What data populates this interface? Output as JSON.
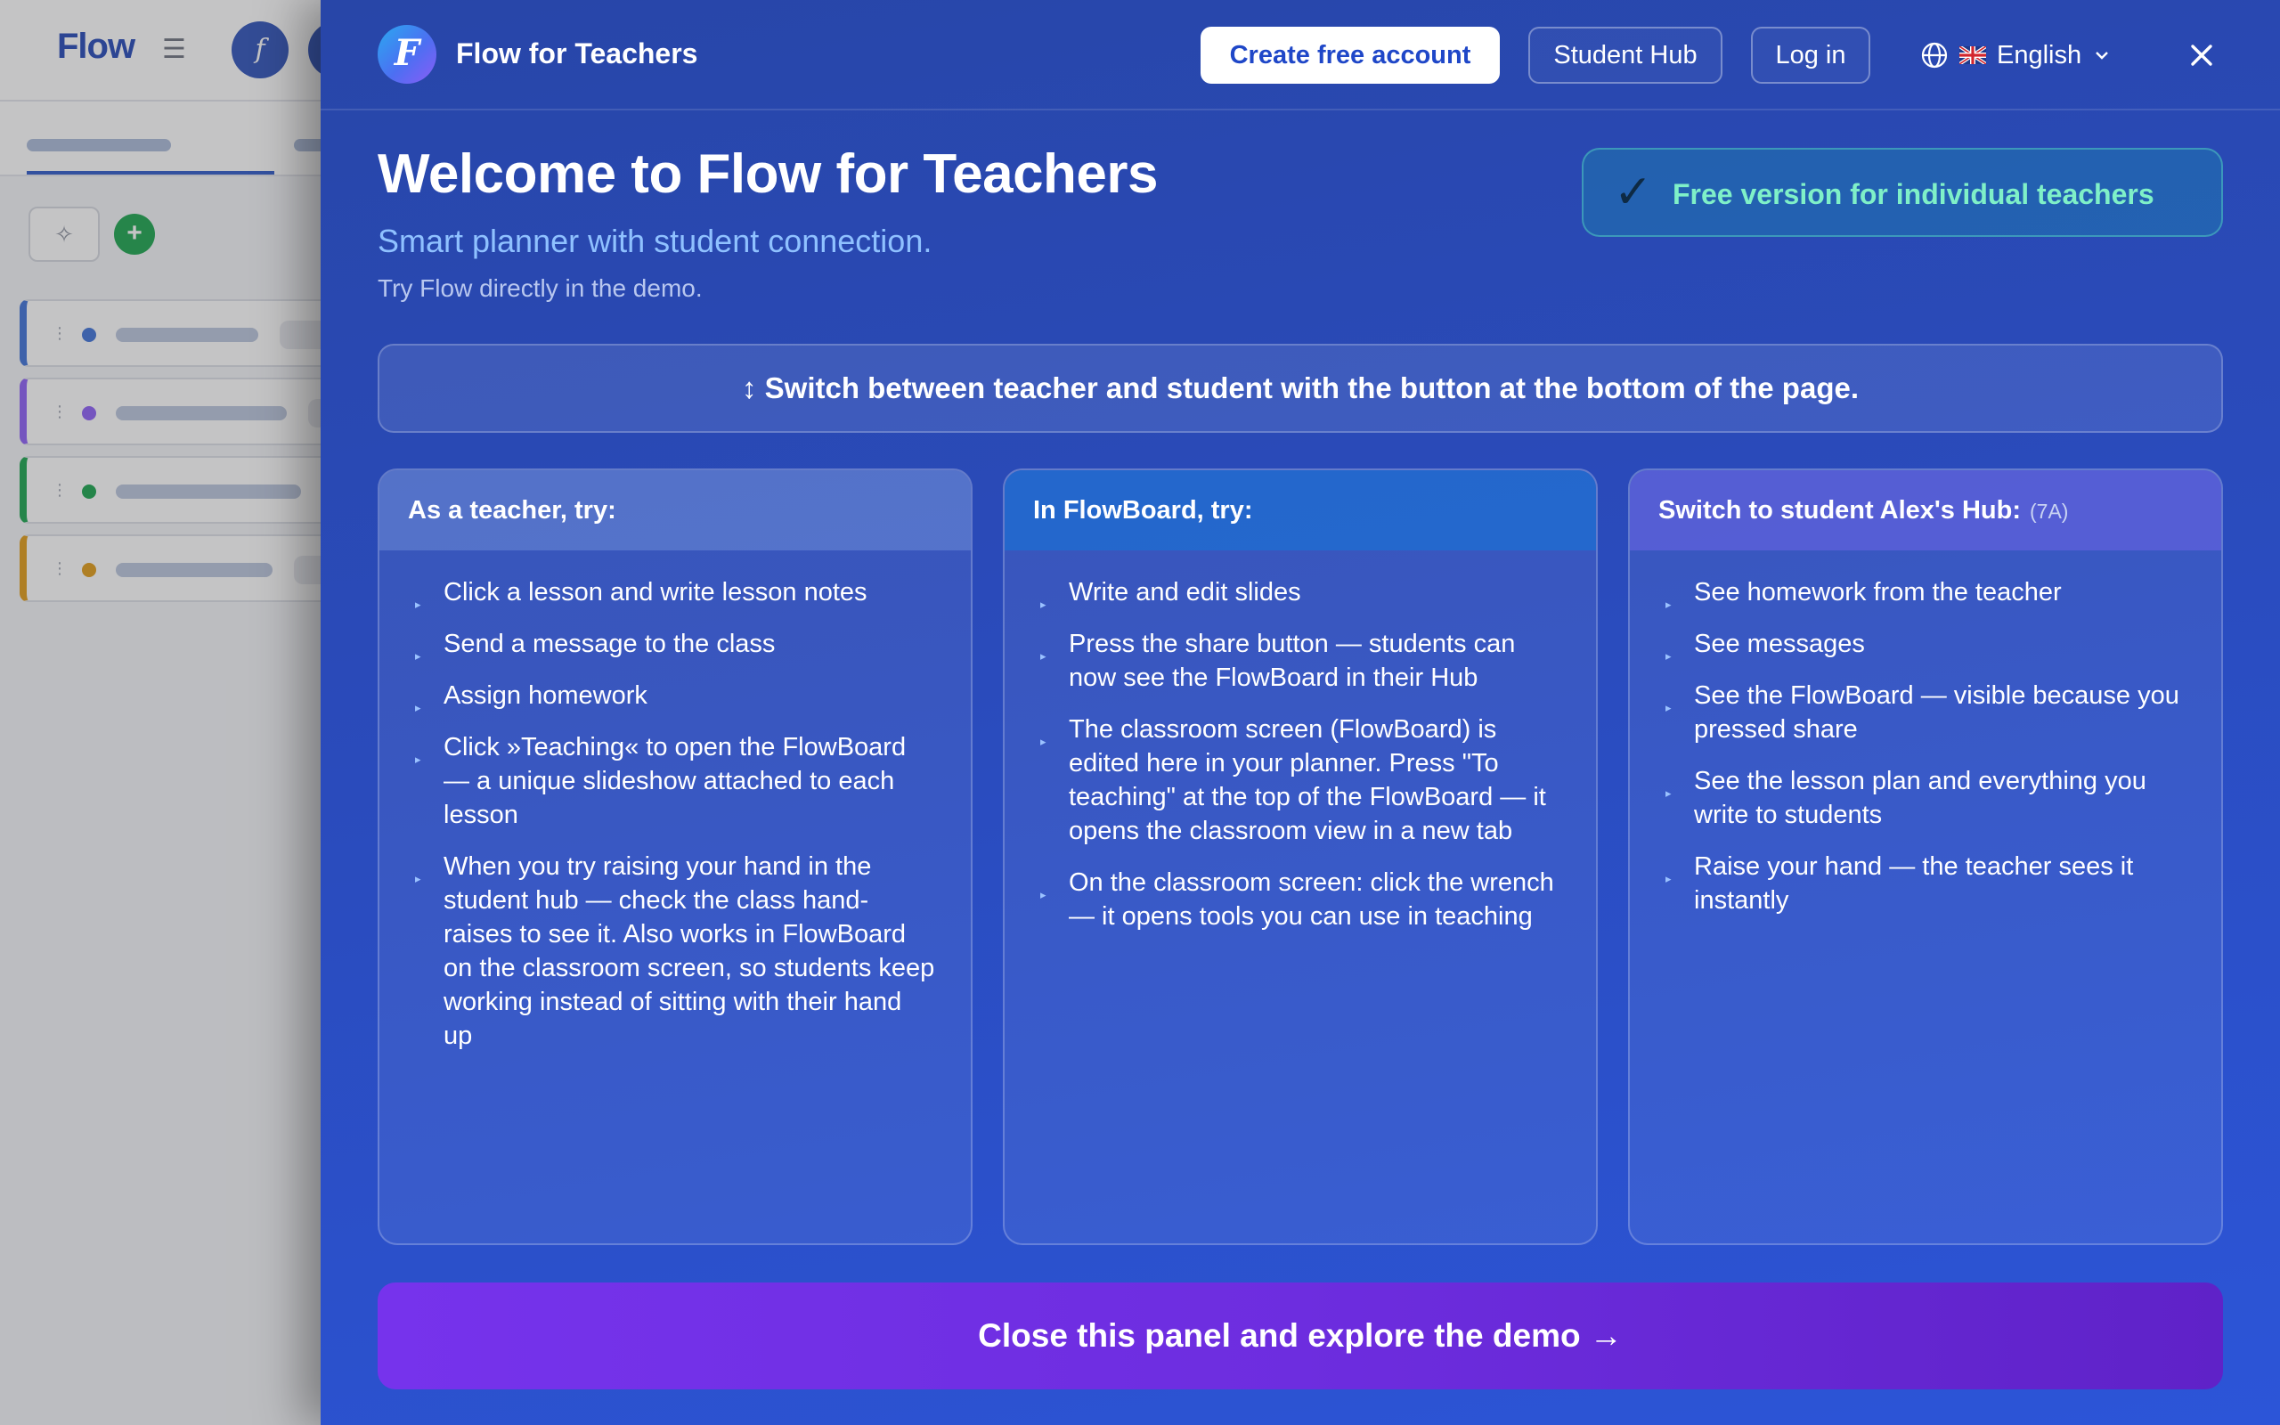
{
  "background_app": {
    "logo": "Flow",
    "avatar_letter": "f"
  },
  "panel": {
    "brand_letter": "F",
    "brand_name": "Flow for Teachers",
    "create_account_label": "Create free account",
    "student_hub_label": "Student Hub",
    "login_label": "Log in",
    "language_label": "English",
    "title": "Welcome to Flow for Teachers",
    "subtitle": "Smart planner with student connection.",
    "hint": "Try Flow directly in the demo.",
    "free_badge": "Free version for individual teachers",
    "switch_banner": "↕ Switch between teacher and student with the button at the bottom of the page.",
    "cards": [
      {
        "title": "As a teacher, try:",
        "items": [
          "Click a lesson and write lesson notes",
          "Send a message to the class",
          "Assign homework",
          "Click »Teaching« to open the FlowBoard — a unique slideshow attached to each lesson",
          "When you try raising your hand in the student hub — check the class hand-raises to see it. Also works in FlowBoard on the classroom screen, so students keep working instead of sitting with their hand up"
        ]
      },
      {
        "title": "In FlowBoard, try:",
        "items": [
          "Write and edit slides",
          "Press the share button — students can now see the FlowBoard in their Hub",
          "The classroom screen (FlowBoard) is edited here in your planner. Press \"To teaching\" at the top of the FlowBoard — it opens the classroom view in a new tab",
          "On the classroom screen: click the wrench — it opens tools you can use in teaching"
        ]
      },
      {
        "title": "Switch to student Alex's Hub:",
        "class_tag": "(7A)",
        "items": [
          "See homework from the teacher",
          "See messages",
          "See the FlowBoard — visible because you pressed share",
          "See the lesson plan and everything you write to students",
          "Raise your hand — the teacher sees it instantly"
        ]
      }
    ],
    "cta_label": "Close this panel and explore the demo →"
  }
}
